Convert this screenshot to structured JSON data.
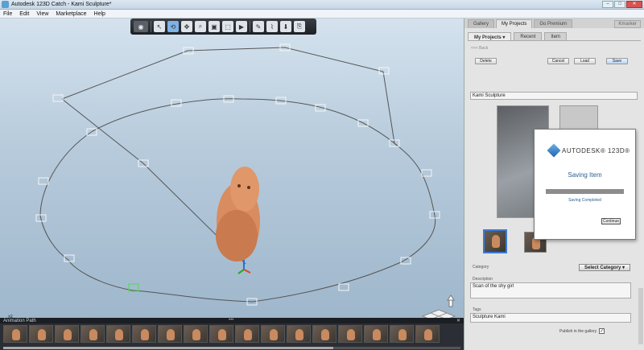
{
  "window": {
    "title": "Autodesk 123D Catch - Kami Sculpture*",
    "minimize": "–",
    "maximize": "□",
    "close": "✕"
  },
  "menu": [
    "File",
    "Edit",
    "View",
    "Marketplace",
    "Help"
  ],
  "toolbar": {
    "icons": [
      "camera-icon",
      "select-icon",
      "orbit-icon",
      "pan-icon",
      "zoom-icon",
      "frame-icon",
      "box-select-icon",
      "video-icon",
      "pen-icon",
      "brush-icon",
      "export-icon",
      "share-icon"
    ]
  },
  "viewport": {
    "axes_label": "xz",
    "viewcube_label": "ViewCube"
  },
  "filmstrip": {
    "label": "Animation Path",
    "dots": "•••",
    "close": "✕",
    "thumb_count": 17
  },
  "panel": {
    "top_tabs": [
      "Gallery",
      "My Projects",
      "Go Premium"
    ],
    "account": "Kmarker",
    "sub_tabs": [
      "My Projects ▾",
      "Recent",
      "Item"
    ],
    "back": "<<< Back",
    "buttons": {
      "delete": "Delete",
      "cancel": "Cancel",
      "load": "Load",
      "save": "Save"
    },
    "name": "Kami Sculpture",
    "category_label": "Category",
    "category_value": "Select Category ▾",
    "description_label": "Description",
    "description": "Scan of the shy girl",
    "tags_label": "Tags",
    "tags": "Sculpture Kami",
    "publish_label": "Publish in the gallery",
    "publish_checked": "✓"
  },
  "dialog": {
    "brand": "AUTODESK® 123D®",
    "heading": "Saving Item",
    "status": "Saving Completed",
    "progress": 1.0,
    "continue": "Continue"
  }
}
